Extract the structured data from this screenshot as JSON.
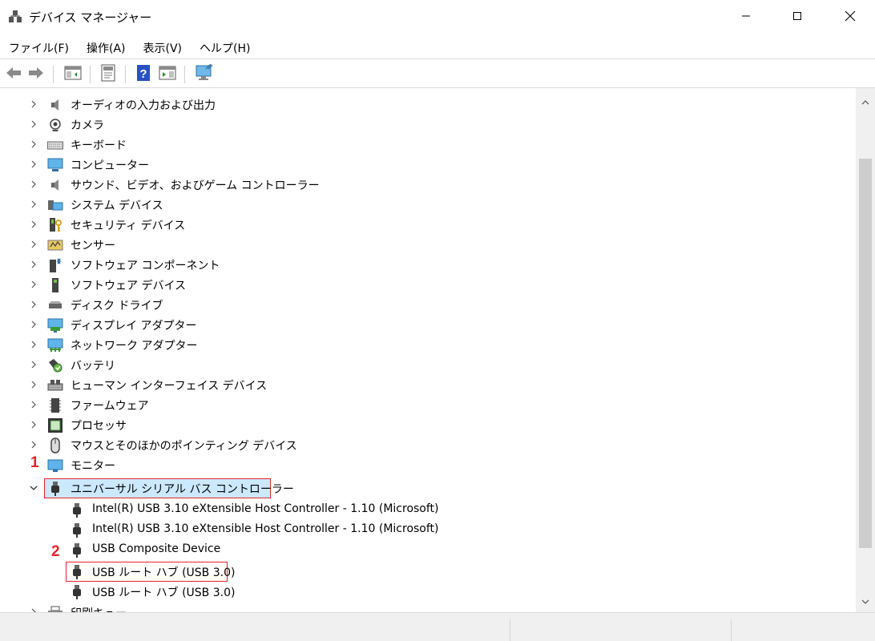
{
  "window": {
    "title": "デバイス マネージャー"
  },
  "menu": [
    {
      "label": "ファイル(F)"
    },
    {
      "label": "操作(A)"
    },
    {
      "label": "表示(V)"
    },
    {
      "label": "ヘルプ(H)"
    }
  ],
  "toolbar": [
    {
      "icon": "back-arrow-icon"
    },
    {
      "icon": "forward-arrow-icon"
    },
    {
      "icon": "show-hide-console-tree-icon"
    },
    {
      "icon": "properties-icon"
    },
    {
      "icon": "help-icon"
    },
    {
      "icon": "action-pane-icon"
    },
    {
      "icon": "scan-hardware-changes-icon"
    }
  ],
  "tree": {
    "items": [
      {
        "label": "オーディオの入力および出力",
        "icon": "speaker-icon"
      },
      {
        "label": "カメラ",
        "icon": "camera-icon"
      },
      {
        "label": "キーボード",
        "icon": "keyboard-icon"
      },
      {
        "label": "コンピューター",
        "icon": "computer-icon"
      },
      {
        "label": "サウンド、ビデオ、およびゲーム コントローラー",
        "icon": "speaker-icon"
      },
      {
        "label": "システム デバイス",
        "icon": "system-device-icon"
      },
      {
        "label": "セキュリティ デバイス",
        "icon": "security-key-icon"
      },
      {
        "label": "センサー",
        "icon": "sensor-icon"
      },
      {
        "label": "ソフトウェア コンポーネント",
        "icon": "software-component-icon"
      },
      {
        "label": "ソフトウェア デバイス",
        "icon": "software-device-icon"
      },
      {
        "label": "ディスク ドライブ",
        "icon": "disk-drive-icon"
      },
      {
        "label": "ディスプレイ アダプター",
        "icon": "display-adapter-icon"
      },
      {
        "label": "ネットワーク アダプター",
        "icon": "network-adapter-icon"
      },
      {
        "label": "バッテリ",
        "icon": "battery-icon"
      },
      {
        "label": "ヒューマン インターフェイス デバイス",
        "icon": "hid-icon"
      },
      {
        "label": "ファームウェア",
        "icon": "firmware-icon"
      },
      {
        "label": "プロセッサ",
        "icon": "processor-icon"
      },
      {
        "label": "マウスとそのほかのポインティング デバイス",
        "icon": "mouse-icon"
      },
      {
        "label": "モニター",
        "icon": "monitor-icon"
      },
      {
        "label": "ユニバーサル シリアル バス コントローラー",
        "icon": "usb-icon",
        "expanded": true,
        "selected": true
      }
    ],
    "usb_children": [
      {
        "label": "Intel(R) USB 3.10 eXtensible Host Controller - 1.10 (Microsoft)"
      },
      {
        "label": "Intel(R) USB 3.10 eXtensible Host Controller - 1.10 (Microsoft)"
      },
      {
        "label": "USB Composite Device"
      },
      {
        "label": "USB ルート ハブ (USB 3.0)",
        "highlighted": true
      },
      {
        "label": "USB ルート ハブ (USB 3.0)"
      }
    ],
    "after": [
      {
        "label": "印刷キュー",
        "icon": "printer-icon"
      }
    ]
  },
  "annotations": {
    "marker1": "1",
    "marker2": "2",
    "color": "#e3242b"
  },
  "colors": {
    "selection": "#cce8ff",
    "annotation": "#e3242b"
  }
}
